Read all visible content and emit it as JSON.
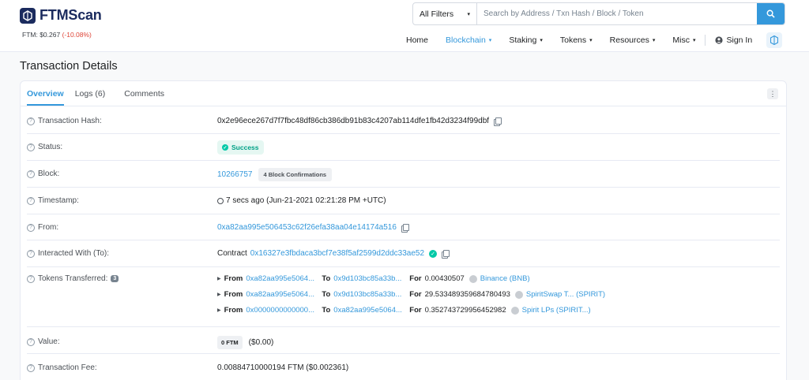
{
  "brand": {
    "name": "FTMScan",
    "price_label": "FTM: $0.267",
    "price_change": "(-10.08%)"
  },
  "search": {
    "filter": "All Filters",
    "placeholder": "Search by Address / Txn Hash / Block / Token"
  },
  "nav": [
    {
      "label": "Home",
      "dropdown": false,
      "active": false
    },
    {
      "label": "Blockchain",
      "dropdown": true,
      "active": true
    },
    {
      "label": "Staking",
      "dropdown": true,
      "active": false
    },
    {
      "label": "Tokens",
      "dropdown": true,
      "active": false
    },
    {
      "label": "Resources",
      "dropdown": true,
      "active": false
    },
    {
      "label": "Misc",
      "dropdown": true,
      "active": false
    }
  ],
  "signin": "Sign In",
  "page_title": "Transaction Details",
  "tabs": [
    "Overview",
    "Logs (6)",
    "Comments"
  ],
  "details": {
    "hash": {
      "label": "Transaction Hash:",
      "value": "0x2e96ece267d7f7fbc48df86cb386db91b83c4207ab114dfe1fb42d3234f99dbf"
    },
    "status": {
      "label": "Status:",
      "value": "Success"
    },
    "block": {
      "label": "Block:",
      "value": "10266757",
      "confirmations": "4 Block Confirmations"
    },
    "timestamp": {
      "label": "Timestamp:",
      "value": "7 secs ago (Jun-21-2021 02:21:28 PM +UTC)"
    },
    "from": {
      "label": "From:",
      "value": "0xa82aa995e506453c62f26efa38aa04e14174a516"
    },
    "to": {
      "label": "Interacted With (To):",
      "prefix": "Contract",
      "value": "0x16327e3fbdaca3bcf7e38f5af2599d2ddc33ae52"
    },
    "tokens": {
      "label": "Tokens Transferred:",
      "count": "3",
      "from_word": "From",
      "to_word": "To",
      "for_word": "For",
      "transfers": [
        {
          "from": "0xa82aa995e5064...",
          "to": "0x9d103bc85a33b...",
          "amount": "0.00430507",
          "token": "Binance (BNB)"
        },
        {
          "from": "0xa82aa995e5064...",
          "to": "0x9d103bc85a33b...",
          "amount": "29.533489359684780493",
          "token": "SpiritSwap T... (SPIRIT)"
        },
        {
          "from": "0x0000000000000...",
          "to": "0xa82aa995e5064...",
          "amount": "0.352743729956452982",
          "token": "Spirit LPs (SPIRIT...)"
        }
      ]
    },
    "value": {
      "label": "Value:",
      "badge": "0 FTM",
      "usd": "($0.00)"
    },
    "fee": {
      "label": "Transaction Fee:",
      "value": "0.00884710000194 FTM ($0.002361)"
    }
  }
}
